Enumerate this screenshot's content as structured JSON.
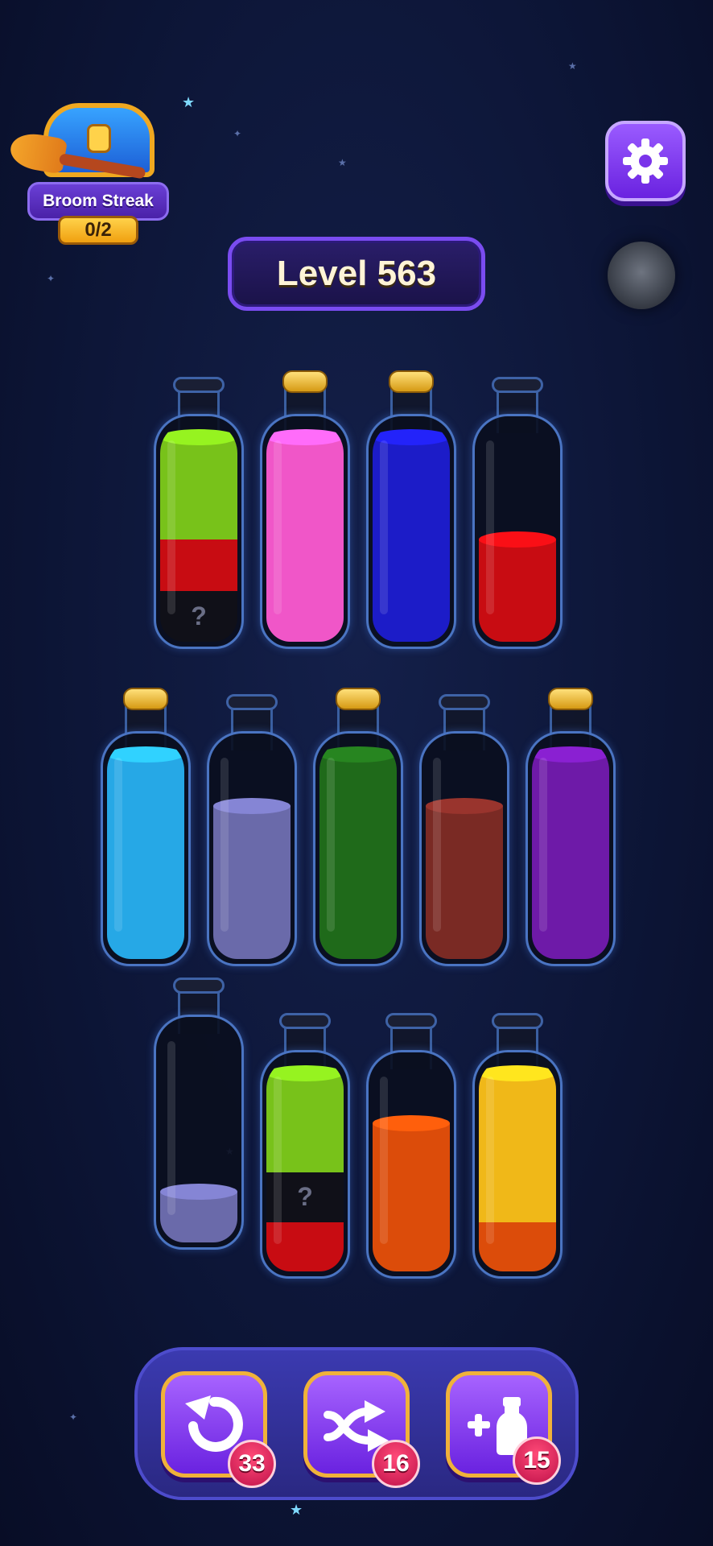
{
  "streak": {
    "label": "Broom Streak",
    "count": "0/2"
  },
  "level": {
    "label": "Level 563"
  },
  "icons": {
    "settings": "gear-icon",
    "undo": "undo-icon",
    "shuffle": "shuffle-icon",
    "add_bottle": "add-bottle-icon"
  },
  "tools": [
    {
      "name": "undo",
      "count": "33"
    },
    {
      "name": "shuffle",
      "count": "16"
    },
    {
      "name": "add-bottle",
      "count": "15"
    }
  ],
  "hidden_marker": "?",
  "colors": {
    "lime": "#78c21a",
    "red": "#c80c12",
    "pink": "#f056c8",
    "blue": "#1c1cc8",
    "cyan": "#26a8e6",
    "lavender": "#6a6aaa",
    "green": "#1f6a1a",
    "brown": "#7a2a24",
    "purple": "#6e1aa8",
    "orange": "#dc4c0a",
    "yellow": "#f0b818",
    "cork": "#e0a828",
    "accent": "#7a4cf0"
  },
  "bottles": [
    {
      "capacity": 4,
      "corked": false,
      "layers": [
        "hidden",
        "red",
        "lime",
        "lime"
      ]
    },
    {
      "capacity": 4,
      "corked": true,
      "layers": [
        "pink",
        "pink",
        "pink",
        "pink"
      ]
    },
    {
      "capacity": 4,
      "corked": true,
      "layers": [
        "blue",
        "blue",
        "blue",
        "blue"
      ]
    },
    {
      "capacity": 4,
      "corked": false,
      "layers": [
        "red",
        "red"
      ]
    },
    {
      "capacity": 4,
      "corked": true,
      "layers": [
        "cyan",
        "cyan",
        "cyan",
        "cyan"
      ]
    },
    {
      "capacity": 4,
      "corked": false,
      "layers": [
        "lavender",
        "lavender",
        "lavender"
      ]
    },
    {
      "capacity": 4,
      "corked": true,
      "layers": [
        "green",
        "green",
        "green",
        "green"
      ]
    },
    {
      "capacity": 4,
      "corked": false,
      "layers": [
        "brown",
        "brown",
        "brown"
      ]
    },
    {
      "capacity": 4,
      "corked": true,
      "layers": [
        "purple",
        "purple",
        "purple",
        "purple"
      ]
    },
    {
      "capacity": 4,
      "corked": false,
      "layers": [
        "lavender"
      ]
    },
    {
      "capacity": 4,
      "corked": false,
      "layers": [
        "red",
        "hidden",
        "lime",
        "lime"
      ]
    },
    {
      "capacity": 4,
      "corked": false,
      "layers": [
        "orange",
        "orange",
        "orange"
      ]
    },
    {
      "capacity": 4,
      "corked": false,
      "layers": [
        "orange",
        "yellow",
        "yellow",
        "yellow"
      ]
    }
  ]
}
